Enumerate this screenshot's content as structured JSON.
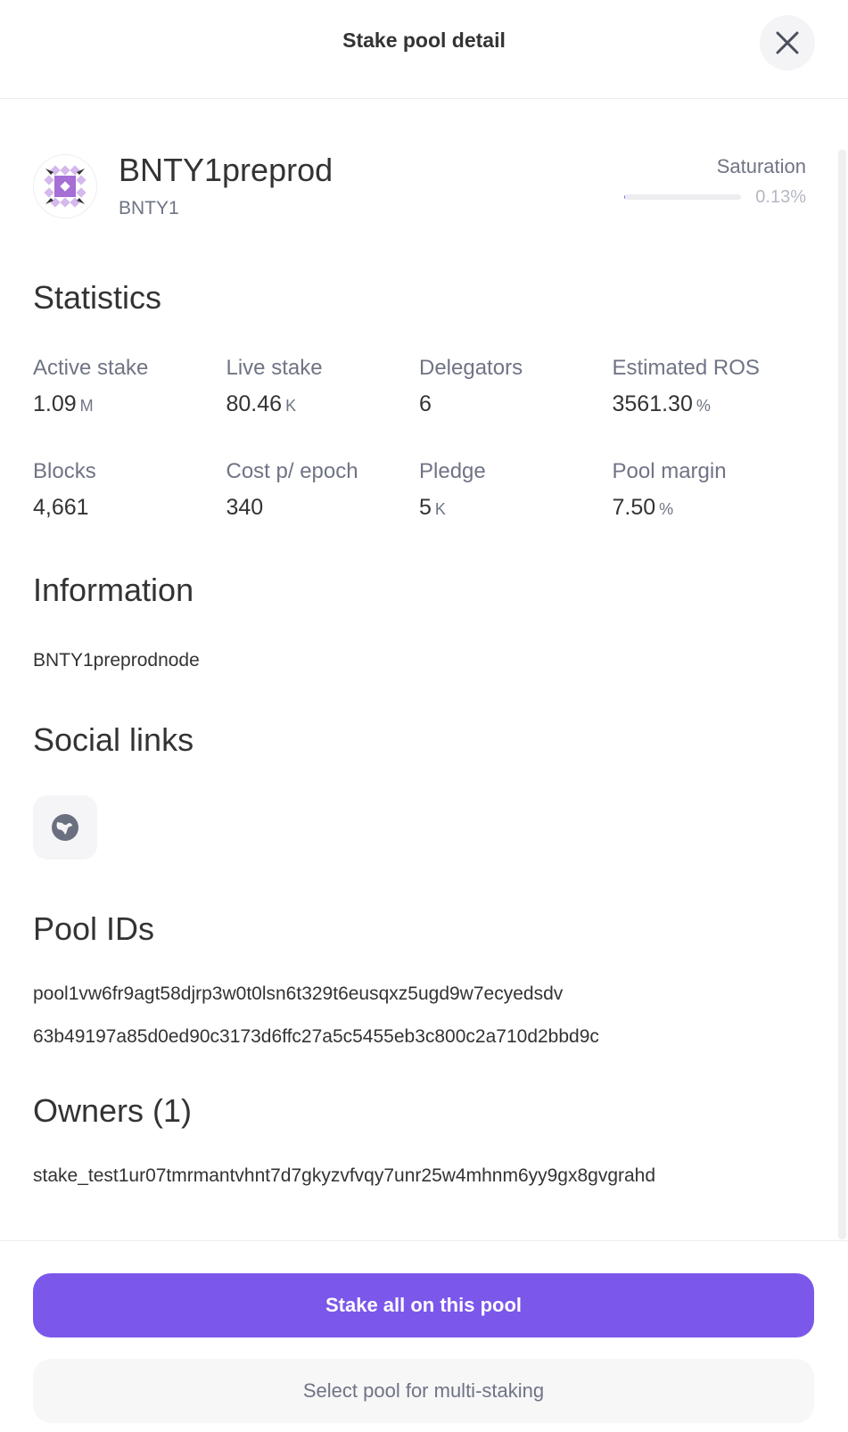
{
  "header": {
    "title": "Stake pool detail"
  },
  "pool": {
    "name": "BNTY1preprod",
    "ticker": "BNTY1",
    "saturation_label": "Saturation",
    "saturation_value": "0.13%",
    "saturation_fraction": 0.0013
  },
  "statistics": {
    "title": "Statistics",
    "items": [
      {
        "label": "Active stake",
        "value": "1.09",
        "unit": "M"
      },
      {
        "label": "Live stake",
        "value": "80.46",
        "unit": "K"
      },
      {
        "label": "Delegators",
        "value": "6",
        "unit": ""
      },
      {
        "label": "Estimated ROS",
        "value": "3561.30",
        "unit": "%"
      },
      {
        "label": "Blocks",
        "value": "4,661",
        "unit": ""
      },
      {
        "label": "Cost p/ epoch",
        "value": "340",
        "unit": ""
      },
      {
        "label": "Pledge",
        "value": "5",
        "unit": "K"
      },
      {
        "label": "Pool margin",
        "value": "7.50",
        "unit": "%"
      }
    ]
  },
  "information": {
    "title": "Information",
    "text": "BNTY1preprodnode"
  },
  "social": {
    "title": "Social links",
    "icon": "globe-icon"
  },
  "pool_ids": {
    "title": "Pool IDs",
    "ids": [
      "pool1vw6fr9agt58djrp3w0t0lsn6t329t6eusqxz5ugd9w7ecyedsdv",
      "63b49197a85d0ed90c3173d6ffc27a5c5455eb3c800c2a710d2bbd9c"
    ]
  },
  "owners": {
    "title": "Owners (1)",
    "items": [
      "stake_test1ur07tmrmantvhnt7d7gkyzvfvqy7unr25w4mhnm6yy9gx8gvgrahd"
    ]
  },
  "actions": {
    "stake_all": "Stake all on this pool",
    "multi": "Select pool for multi-staking"
  }
}
